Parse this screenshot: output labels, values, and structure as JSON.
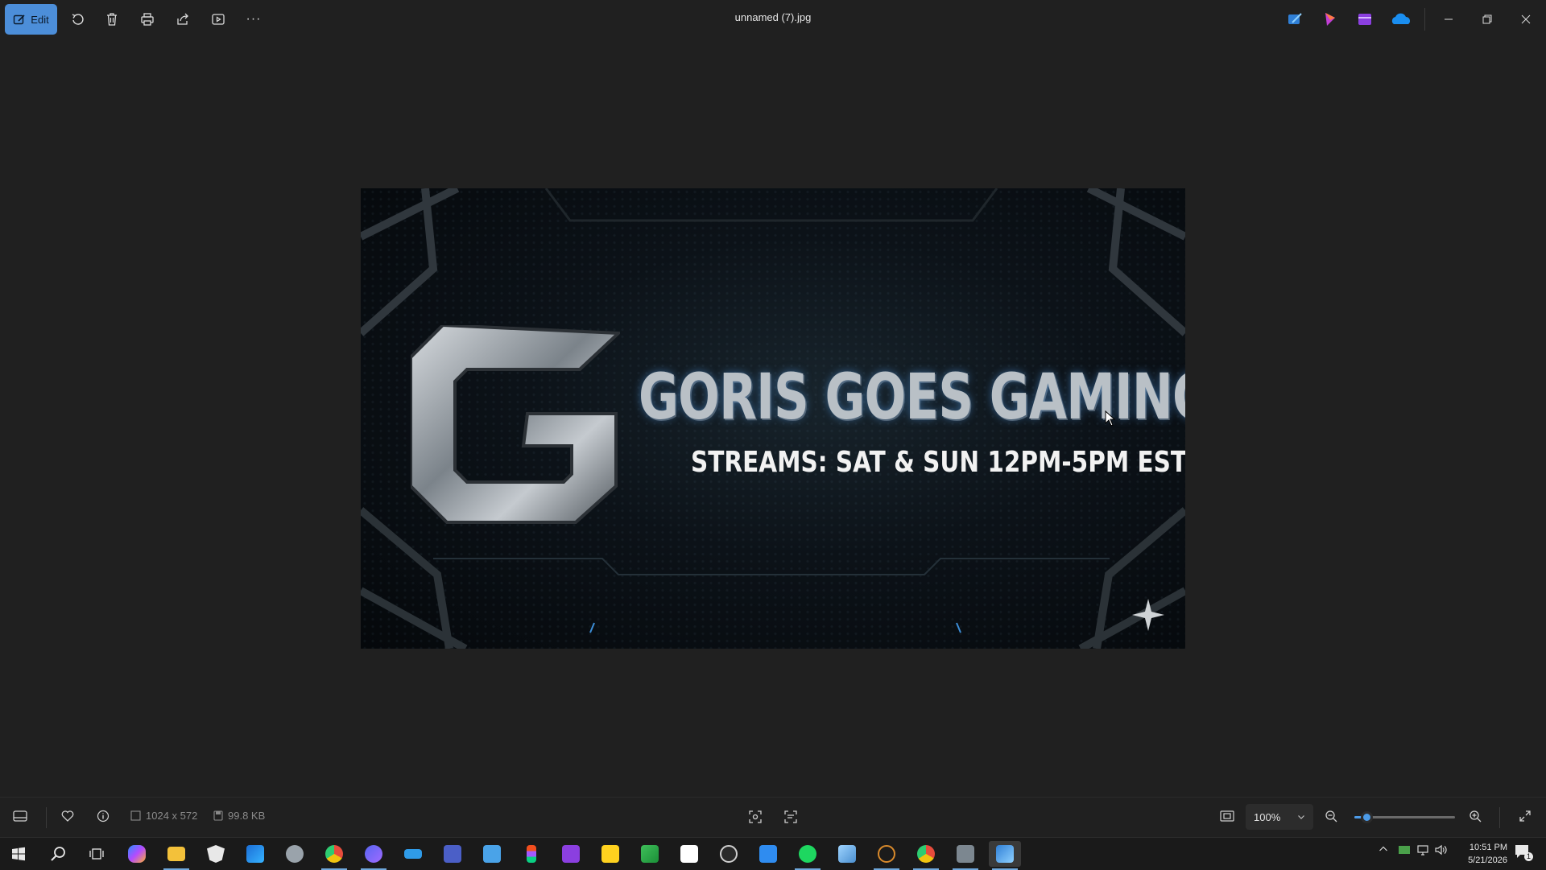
{
  "titlebar": {
    "edit_label": "Edit",
    "title": "unnamed (7).jpg",
    "tools": [
      "rotate-icon",
      "delete-icon",
      "print-icon",
      "share-icon",
      "slideshow-icon",
      "more-icon"
    ],
    "more_glyph": "···",
    "app_icons": [
      "photos-edit-app-icon",
      "clipchamp-icon",
      "video-editor-icon",
      "onedrive-icon"
    ],
    "window_controls": [
      "minimize-icon",
      "restore-icon",
      "close-icon"
    ]
  },
  "image": {
    "banner_title": "GORIS GOES GAMING",
    "banner_subtitle": "STREAMS: SAT & SUN 12PM-5PM EST"
  },
  "statusbar": {
    "dimensions": "1024 x 572",
    "file_size": "99.8 KB",
    "zoom_value": "100%",
    "zoom_slider_fraction": 0.12
  },
  "taskbar": {
    "apps": [
      "start-icon",
      "search-icon",
      "task-view-icon",
      "copilot-icon",
      "file-explorer-icon",
      "security-icon",
      "outlook-icon",
      "shield-app-icon",
      "chrome-icon",
      "messenger-icon",
      "heartrate-app-icon",
      "teams-icon",
      "remote-desktop-icon",
      "figma-icon",
      "clipchamp-icon",
      "sticky-notes-icon",
      "green-app-icon",
      "roblox-icon",
      "obs-icon",
      "calendar-icon",
      "spotify-icon",
      "notepad-icon",
      "circle-app-icon",
      "chrome-profile-icon",
      "game-app-icon",
      "photos-icon"
    ],
    "clock_time": "10:51 PM",
    "clock_date": "5/21/2026",
    "notification_count": "1"
  },
  "colors": {
    "accent": "#4c8ed9",
    "background": "#202020",
    "taskbar": "#1a1a1a"
  }
}
